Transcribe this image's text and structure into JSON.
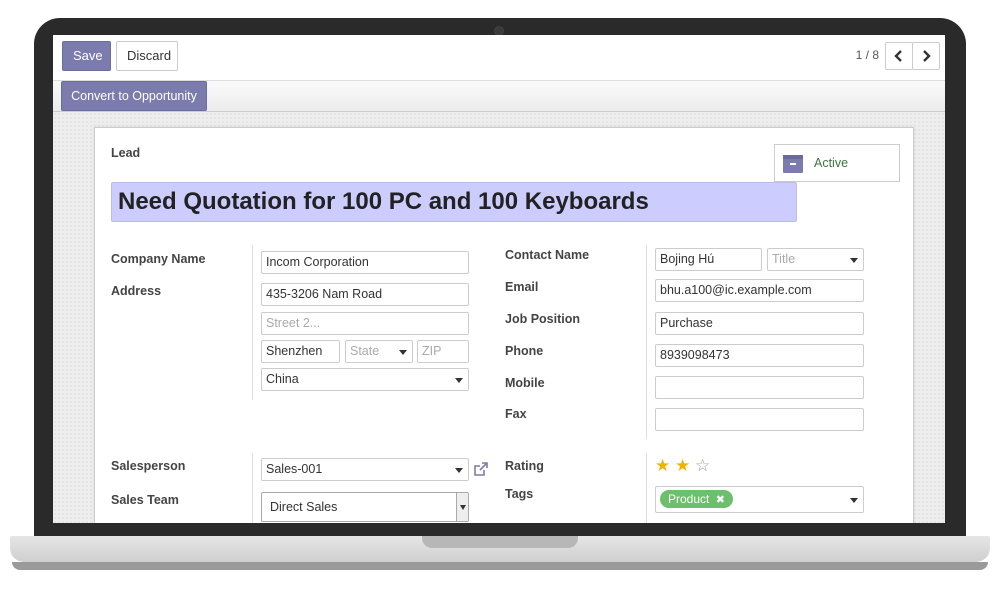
{
  "toolbar": {
    "save_label": "Save",
    "discard_label": "Discard",
    "pager_value": "1 / 8",
    "prev_icon": "chevron-left-icon",
    "next_icon": "chevron-right-icon"
  },
  "statusbar": {
    "convert_label": "Convert to Opportunity"
  },
  "colors": {
    "primary": "#7c7bad",
    "title_bg": "#ccccff",
    "active_text": "#3c763d",
    "star": "#f0b400",
    "tag": "#6cc06c"
  },
  "form": {
    "type_label": "Lead",
    "title": "Need Quotation for 100 PC and 100 Keyboards",
    "active_button": {
      "icon": "archive-icon",
      "label": "Active"
    },
    "left": {
      "company_name_label": "Company Name",
      "company_name_value": "Incom Corporation",
      "address_label": "Address",
      "street_value": "435-3206 Nam Road",
      "street2_placeholder": "Street 2...",
      "city_value": "Shenzhen",
      "state_placeholder": "State",
      "zip_placeholder": "ZIP",
      "country_value": "China"
    },
    "right": {
      "contact_name_label": "Contact Name",
      "contact_name_value": "Bojing Hú",
      "title_placeholder": "Title",
      "email_label": "Email",
      "email_value": "bhu.a100@ic.example.com",
      "job_position_label": "Job Position",
      "job_position_value": "Purchase",
      "phone_label": "Phone",
      "phone_value": "8939098473",
      "mobile_label": "Mobile",
      "mobile_value": "",
      "fax_label": "Fax",
      "fax_value": ""
    },
    "lower_left": {
      "salesperson_label": "Salesperson",
      "salesperson_value": "Sales-001",
      "external_link_icon": "external-link-icon",
      "sales_team_label": "Sales Team",
      "sales_team_value": "Direct Sales"
    },
    "lower_right": {
      "rating_label": "Rating",
      "rating_value": 2,
      "rating_max": 3,
      "tags_label": "Tags",
      "tag_label": "Product",
      "tag_remove_icon": "close-icon"
    }
  }
}
